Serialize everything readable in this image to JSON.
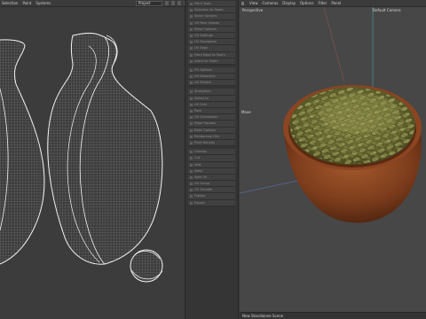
{
  "uv_editor": {
    "menu": [
      "Selection",
      "Paint",
      "Systems"
    ],
    "project_select": "Project"
  },
  "tool_panel": {
    "items": [
      "Paint Tools",
      "Selection to Seam",
      "Seam Options",
      "UV Pack Islands",
      "Relax Options",
      "UV Settings",
      "UV Straighten",
      "UV Align",
      "Hard Edge to Seam",
      "Island to Seam",
      "",
      "Fill Options",
      "UV Distortion",
      "UV Stretch",
      "",
      "Straighten",
      "Select to",
      "UV Grid",
      "Pack",
      "UV Orientation",
      "Edge Options",
      "Bake Options",
      "Randomize UVs",
      "Pixel Density",
      "",
      "Unwrap",
      "Cut",
      "Sew",
      "Weld",
      "Split UV",
      "UV Group",
      "UV Transfer",
      "Flatten",
      "Export"
    ]
  },
  "viewport": {
    "menu": [
      "View",
      "Cameras",
      "Display",
      "Options",
      "Filter",
      "Panel"
    ],
    "perspective_label": "Perspective",
    "camera_label": "Default Camera",
    "move_label": "Move",
    "status": "New Standalone Scene"
  }
}
